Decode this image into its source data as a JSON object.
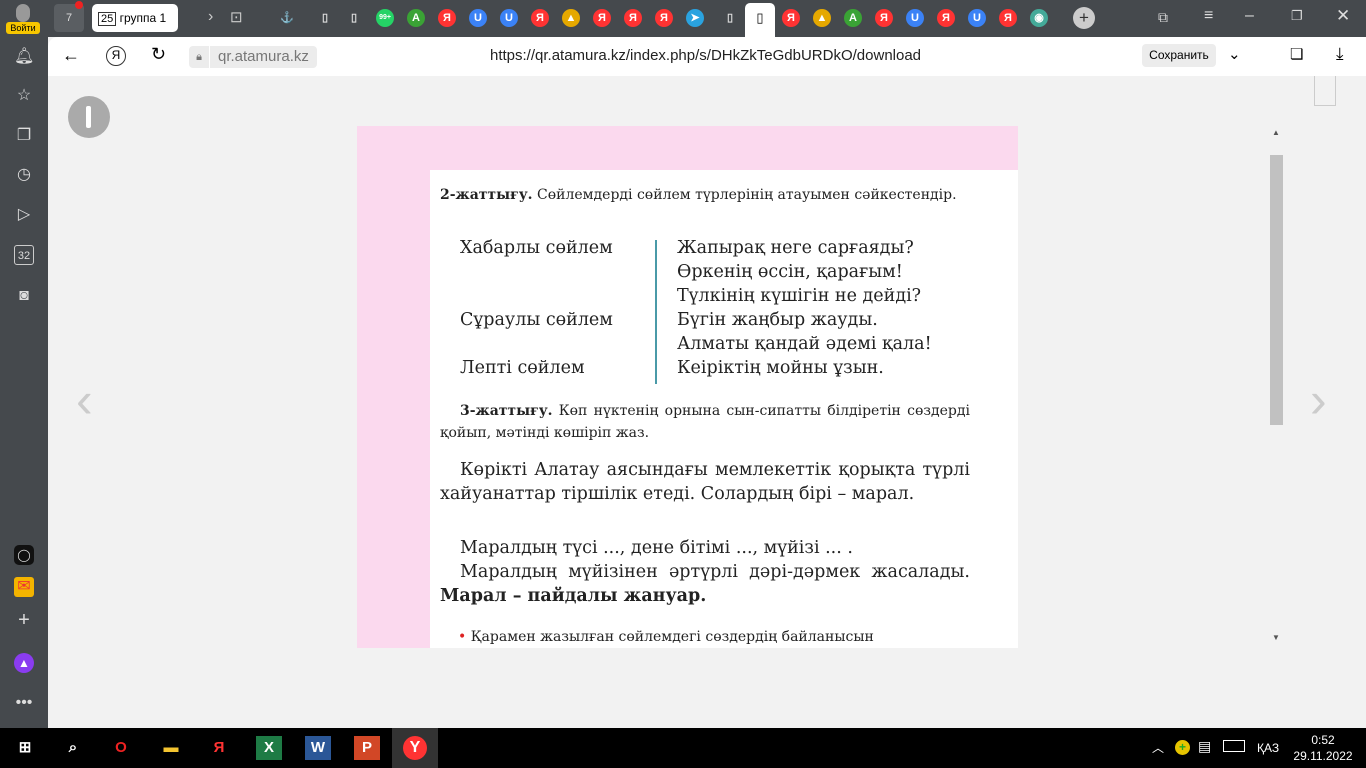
{
  "tabbar": {
    "login_label": "Войти",
    "home_count": "7",
    "active_tab": {
      "count": "25",
      "title": "группа 1"
    },
    "icons": [
      {
        "t": "99+",
        "c": "#25d366"
      },
      {
        "t": "A",
        "c": "#3aa335"
      },
      {
        "t": "Я",
        "c": "#f33"
      },
      {
        "t": "U",
        "c": "#3b82f6"
      },
      {
        "t": "U",
        "c": "#3b82f6"
      },
      {
        "t": "Я",
        "c": "#f33"
      },
      {
        "t": "▲",
        "c": "#e5a800"
      },
      {
        "t": "Я",
        "c": "#f33"
      },
      {
        "t": "Я",
        "c": "#f33"
      },
      {
        "t": "Я",
        "c": "#f33"
      },
      {
        "t": "➤",
        "c": "#2aa3e0"
      }
    ],
    "icons2": [
      {
        "t": "Я",
        "c": "#f33"
      },
      {
        "t": "▲",
        "c": "#e5a800"
      },
      {
        "t": "A",
        "c": "#3aa335"
      },
      {
        "t": "Я",
        "c": "#f33"
      },
      {
        "t": "U",
        "c": "#3b82f6"
      },
      {
        "t": "Я",
        "c": "#f33"
      },
      {
        "t": "U",
        "c": "#3b82f6"
      },
      {
        "t": "Я",
        "c": "#f33"
      },
      {
        "t": "◉",
        "c": "#4a9"
      }
    ]
  },
  "address": {
    "domain": "qr.atamura.kz",
    "url": "https://qr.atamura.kz/index.php/s/DHkZkTeGdbURDkO/download",
    "save_label": "Сохранить"
  },
  "sidebar": {
    "badge": "32"
  },
  "doc": {
    "ex2_title": "2-жаттығу.",
    "ex2_text": "Сөйлемдерді сөйлем түрлерінің атауымен сәйкестендір.",
    "left": [
      "Хабарлы сөйлем",
      "Сұраулы сөйлем",
      "Лепті сөйлем"
    ],
    "right": [
      "Жапырақ неге сарғаяды?",
      "Өркенің өссін, қарағым!",
      "Түлкінің күшігін не дейді?",
      "Бүгін жаңбыр жауды.",
      "Алматы қандай әдемі қала!",
      "Кеіріктің мойны ұзын."
    ],
    "ex3_title": "3-жаттығу.",
    "ex3_text": "Көп нүктенің орнына сын-сипатты білдіретін сөздерді қойып, мәтінді көшіріп жаз.",
    "para1": "Көрікті Алатау аясындағы мемлекеттік қорықта түрлі хайуанаттар тіршілік етеді. Солардың бірі – марал.",
    "para2": "Маралдың түсі ..., дене бітімі ..., мүйізі ... .",
    "para3": "Маралдың мүйізінен әртүрлі дәрі-дәрмек жасалады.",
    "para3_bold": "Марал – пайдалы жануар.",
    "bullet": "Қарамен жазылған сөйлемдегі сөздердің байланысын"
  },
  "taskbar": {
    "lang": "ҚАЗ",
    "time": "0:52",
    "date": "29.11.2022"
  }
}
